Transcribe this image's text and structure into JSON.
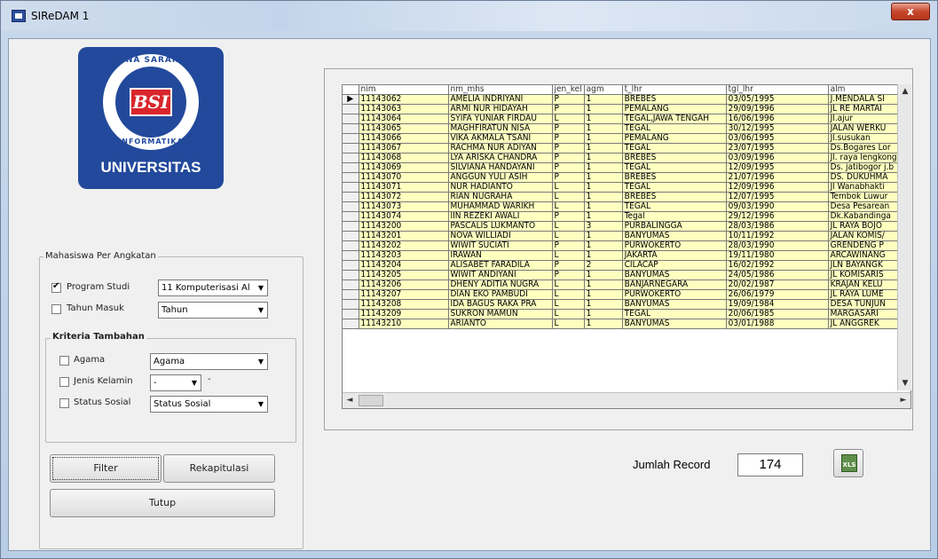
{
  "window": {
    "title": "SIReDAM 1",
    "close_glyph": "x"
  },
  "logo": {
    "arc_top": "BINA SARANA",
    "emblem": "BSI",
    "arc_bottom": "INFORMATIKA",
    "text": "UNIVERSITAS"
  },
  "filter_group": {
    "caption": "Mahasiswa Per Angkatan",
    "program_studi": {
      "label": "Program Studi",
      "checked": true,
      "value": "11  Komputerisasi Al"
    },
    "tahun_masuk": {
      "label": "Tahun Masuk",
      "checked": false,
      "value": "Tahun"
    },
    "kriteria": {
      "caption": "Kriteria Tambahan",
      "agama": {
        "label": "Agama",
        "checked": false,
        "value": "Agama"
      },
      "jenis_kelamin": {
        "label": "Jenis Kelamin",
        "checked": false,
        "value": "-",
        "suffix": "-"
      },
      "status_sosial": {
        "label": "Status Sosial",
        "checked": false,
        "value": "Status Sosial"
      }
    }
  },
  "buttons": {
    "filter": "Filter",
    "rekapitulasi": "Rekapitulasi",
    "tutup": "Tutup"
  },
  "grid": {
    "columns": [
      "nim",
      "nm_mhs",
      "jen_kel",
      "agm",
      "t_lhr",
      "tgl_lhr",
      "alm"
    ],
    "rows": [
      [
        "11143062",
        "AMELIA INDRIYANI",
        "P",
        "1",
        "BREBES",
        "03/05/1995",
        "J.MENDALA SI"
      ],
      [
        "11143063",
        "ARMI NUR HIDAYAH",
        "P",
        "1",
        "PEMALANG",
        "29/09/1996",
        "JL RE MARTAI"
      ],
      [
        "11143064",
        "SYIFA YUNIAR FIRDAU",
        "L",
        "1",
        "TEGAL,JAWA TENGAH",
        "16/06/1996",
        "Jl.ajur"
      ],
      [
        "11143065",
        "MAGHFIRATUN NISA",
        "P",
        "1",
        "TEGAL",
        "30/12/1995",
        "JALAN WERKU"
      ],
      [
        "11143066",
        "VIKA AKMALA TSANI",
        "P",
        "1",
        "PEMALANG",
        "03/06/1995",
        "Jl.susukan"
      ],
      [
        "11143067",
        "RACHMA NUR ADIYAN",
        "P",
        "1",
        "TEGAL",
        "23/07/1995",
        "Ds.Bogares Lor"
      ],
      [
        "11143068",
        "LYA ARISKA CHANDRA",
        "P",
        "1",
        "BREBES",
        "03/09/1996",
        "Jl. raya lengkong"
      ],
      [
        "11143069",
        "SILVIANA HANDAYANI",
        "P",
        "1",
        "TEGAL",
        "12/09/1995",
        "Ds. jatibogor j.b"
      ],
      [
        "11143070",
        "ANGGUN YULI ASIH",
        "P",
        "1",
        "BREBES",
        "21/07/1996",
        "DS. DUKUHMA"
      ],
      [
        "11143071",
        "NUR HADIANTO",
        "L",
        "1",
        "TEGAL",
        "12/09/1996",
        "Jl Wanabhakti"
      ],
      [
        "11143072",
        "RIAN NUGRAHA",
        "L",
        "1",
        "BREBES",
        "12/07/1995",
        "Tembok Luwur"
      ],
      [
        "11143073",
        "MUHAMMAD WARIKH",
        "L",
        "1",
        "TEGAL",
        "09/03/1990",
        "Desa Pesarean"
      ],
      [
        "11143074",
        "IIN REZEKI AWALI",
        "P",
        "1",
        "Tegal",
        "29/12/1996",
        "Dk.Kabandinga"
      ],
      [
        "11143200",
        "PASCALIS LUKMANTO",
        "L",
        "3",
        "PURBALINGGA",
        "28/03/1986",
        "JL RAYA BOJO"
      ],
      [
        "11143201",
        "NOVA WILLIADI",
        "L",
        "1",
        "BANYUMAS",
        "10/11/1992",
        "JALAN KOMIS/"
      ],
      [
        "11143202",
        "WIWIT SUCIATI",
        "P",
        "1",
        "PURWOKERTO",
        "28/03/1990",
        "GRENDENG P"
      ],
      [
        "11143203",
        "IRAWAN",
        "L",
        "1",
        "JAKARTA",
        "19/11/1980",
        "ARCAWINANG"
      ],
      [
        "11143204",
        "ALISABET FARADILA",
        "P",
        "2",
        "CILACAP",
        "16/02/1992",
        "JLN BAYANGK"
      ],
      [
        "11143205",
        "WIWIT ANDIYANI",
        "P",
        "1",
        "BANYUMAS",
        "24/05/1986",
        "JL KOMISARIS"
      ],
      [
        "11143206",
        "DHENY ADITIA NUGRA",
        "L",
        "1",
        "BANJARNEGARA",
        "20/02/1987",
        "KRAJAN KELU"
      ],
      [
        "11143207",
        "DIAN EKO PAMBUDI",
        "L",
        "1",
        "PURWOKERTO",
        "26/06/1979",
        "JL RAYA LUME"
      ],
      [
        "11143208",
        "IDA BAGUS RAKA PRA",
        "L",
        "1",
        "BANYUMAS",
        "19/09/1984",
        "DESA TUNJUN"
      ],
      [
        "11143209",
        "SUKRON MAMUN",
        "L",
        "1",
        "TEGAL",
        "20/06/1985",
        "MARGASARI"
      ],
      [
        "11143210",
        "ARIANTO",
        "L",
        "1",
        "BANYUMAS",
        "03/01/1988",
        "JL ANGGREK"
      ]
    ]
  },
  "record": {
    "label": "Jumlah Record",
    "count": "174"
  },
  "export_button": {
    "icon": "excel-icon",
    "text": "XLS"
  }
}
